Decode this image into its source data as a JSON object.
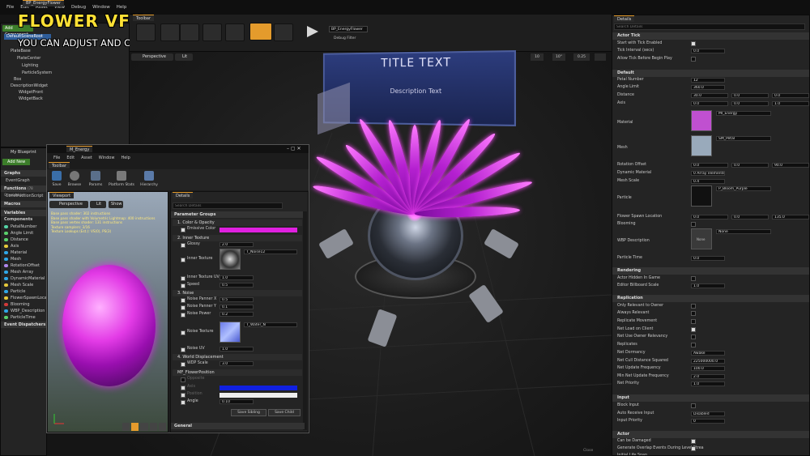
{
  "overlay": {
    "headline": "FLOWER VFX",
    "subline": "YOU CAN ADJUST AND CHANGE ALL PARAMETERS (PETAL NUMBER, AXIS, ANIMATION, PETAL SHAPE, ANGLE, SCALE, ETC.)"
  },
  "menu": [
    "File",
    "Edit",
    "Asset",
    "View",
    "Debug",
    "Window",
    "Help"
  ],
  "tabs": {
    "main": "BP_EnergyFlower",
    "toolbar": "Toolbar",
    "details": "Details",
    "my_blueprint": "My Blueprint",
    "viewport": "Viewport"
  },
  "toolbar": {
    "add_label": "Add Component",
    "debug_filter": "Debug Filter",
    "debug_value": "BP_EnergyFlower"
  },
  "components": {
    "root": "DefaultSceneRoot",
    "items": [
      "PlateBase",
      "PlateCenter",
      "Lighting",
      "ParticleSystem",
      "Box",
      "DescriptionWidget",
      "WidgetFront",
      "WidgetBack"
    ]
  },
  "my_blueprint": {
    "add_new": "Add New",
    "graphs": "Graphs",
    "event_graph": "EventGraph",
    "functions": "Functions",
    "functions_count": "(78 Overridable)",
    "construction_script": "ConstructionScript",
    "macros": "Macros",
    "variables": "Variables",
    "components_label": "Components",
    "variables_list": [
      "PetalNumber",
      "Angle Limit",
      "Distance",
      "Axis",
      "Material",
      "Mesh",
      "RotationOffset",
      "Mesh Array",
      "DynamicMaterial",
      "Mesh Scale",
      "Particle",
      "FlowerSpawnLocation",
      "Blooming",
      "WBP_Description",
      "ParticleTime"
    ],
    "event_dispatchers": "Event Dispatchers",
    "variable_colors": [
      "#54d3a6",
      "#5ad16b",
      "#5ad16b",
      "#e6c93b",
      "#2fa7e8",
      "#2fa7e8",
      "#b087ec",
      "#2fa7e8",
      "#2fa7e8",
      "#e6c93b",
      "#2fa7e8",
      "#e6c93b",
      "#d23a3a",
      "#2fa7e8",
      "#5ad16b"
    ]
  },
  "viewport": {
    "mode": "Perspective",
    "lit": "Lit",
    "snap_grid": "10",
    "snap_angle": "10°",
    "snap_scale": "0.25",
    "widget_title": "TITLE TEXT",
    "widget_desc": "Description Text",
    "bottom_hint": "Close"
  },
  "mat_editor": {
    "title": "M_Energy",
    "menu": [
      "File",
      "Edit",
      "Asset",
      "Window",
      "Help"
    ],
    "toolbar_tab": "Toolbar",
    "tools": [
      "Save",
      "Browse",
      "Params",
      "Platform Stats",
      "Hierarchy"
    ],
    "viewport_tab": "Viewport",
    "viewport_mode": "Perspective",
    "viewport_lit": "Lit",
    "viewport_show": "Show",
    "stats": [
      "Base pass shader: 302 instructions",
      "Base pass shader with Volumetric Lightmap: 400 instructions",
      "Base pass vertex shader: 131 instructions",
      "Texture samplers: 3/16",
      "Texture Lookups (Est.): VS(0), PS(3)"
    ],
    "details_tab": "Details",
    "search_placeholder": "Search Details",
    "param_groups": "Parameter Groups",
    "groups": [
      "1. Color & Opacity",
      "2. Inner Texture",
      "3. Noise",
      "4. World Displacement",
      "MF_FlowerPosition"
    ],
    "params": [
      {
        "label": "Emissive Color",
        "value": ""
      },
      {
        "label": "Glossy",
        "value": "2.0"
      },
      {
        "label": "Inner Texture",
        "value": "T_Noise12"
      },
      {
        "label": "Inner Texture UV",
        "value": "1.0"
      },
      {
        "label": "Speed",
        "value": "0.5"
      },
      {
        "label": "Noise Panner X",
        "value": "0.5"
      },
      {
        "label": "Noise Panner Y",
        "value": "0.1"
      },
      {
        "label": "Noise Power",
        "value": "0.2"
      },
      {
        "label": "Noise Texture",
        "value": "T_Water_N"
      },
      {
        "label": "Noise UV",
        "value": "1.0"
      },
      {
        "label": "WDP Scale",
        "value": "3.0"
      },
      {
        "label": "Opposite",
        "value": ""
      },
      {
        "label": "Axis",
        "value": ""
      },
      {
        "label": "Position",
        "value": ""
      },
      {
        "label": "Angle",
        "value": "0.10"
      }
    ],
    "save_sibling": "Save Sibling",
    "save_child": "Save Child",
    "general": "General"
  },
  "details": {
    "search_placeholder": "Search Details",
    "actor_tick": "Actor Tick",
    "start_tick": "Start with Tick Enabled",
    "tick_interval": "Tick Interval (secs)",
    "tick_interval_val": "0.0",
    "allow_tick": "Allow Tick Before Begin Play",
    "default": "Default",
    "petal_number": "Petal Number",
    "petal_number_val": "12",
    "angle_limit": "Angle Limit",
    "angle_limit_val": "360.0",
    "distance": "Distance",
    "dist_x": "30.0",
    "dist_y": "0.0",
    "dist_z": "0.0",
    "axis": "Axis",
    "axis_x": "0.0",
    "axis_y": "0.0",
    "axis_z": "1.0",
    "material": "Material",
    "material_val": "MI_Energy",
    "mesh": "Mesh",
    "mesh_val": "SM_Petal",
    "rotation_offset": "Rotation Offset",
    "rot_x": "0.0",
    "rot_y": "0.0",
    "rot_z": "90.0",
    "dynamic_material": "Dynamic Material",
    "dynamic_material_val": "0 Array elements",
    "mesh_scale": "Mesh Scale",
    "mesh_scale_val": "0.4",
    "particle": "Particle",
    "particle_val": "P_Bloom_Purple",
    "flower_spawn": "Flower Spawn Location",
    "fs_x": "0.0",
    "fs_y": "0.0",
    "fs_z": "135.0",
    "blooming": "Blooming",
    "wbp_desc": "WBP Description",
    "wbp_desc_val": "None",
    "wbp_thumb": "None",
    "particle_time": "Particle Time",
    "particle_time_val": "0.0",
    "rendering": "Rendering",
    "hidden_game": "Actor Hidden In Game",
    "billboard": "Editor Billboard Scale",
    "billboard_val": "1.0",
    "replication": "Replication",
    "rep_items": [
      "Only Relevant to Owner",
      "Always Relevant",
      "Replicate Movement",
      "Net Load on Client",
      "Net Use Owner Relevancy",
      "Replicates",
      "Net Dormancy",
      "Net Cull Distance Squared",
      "Net Update Frequency",
      "Min Net Update Frequency",
      "Net Priority"
    ],
    "net_dormancy": "Awake",
    "net_cull": "225000000.0",
    "net_update": "100.0",
    "min_net_update": "2.0",
    "net_priority": "1.0",
    "input": "Input",
    "block_input": "Block Input",
    "auto_receive": "Auto Receive Input",
    "auto_receive_val": "Disabled",
    "input_priority": "Input Priority",
    "input_priority_val": "0",
    "actor": "Actor",
    "can_damaged": "Can be Damaged",
    "gen_overlap": "Generate Overlap Events During Level Strea",
    "life_span": "Initial Life Span"
  },
  "colors": {
    "accent": "#e49b2c",
    "magenta": "#e020e0",
    "selection": "#2e5d9a"
  }
}
